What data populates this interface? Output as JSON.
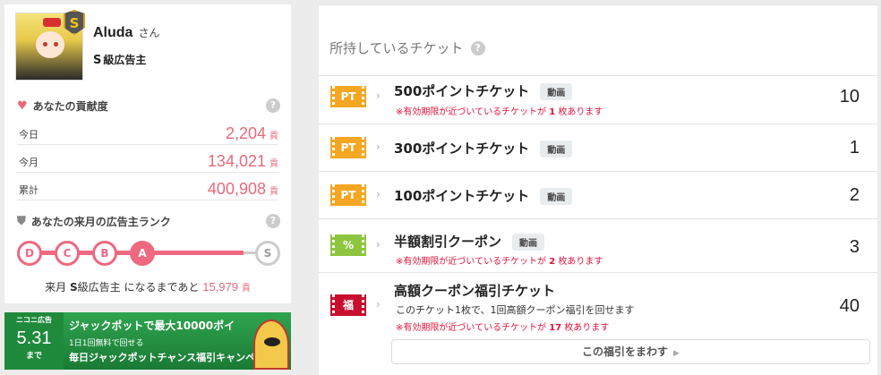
{
  "user": {
    "name": "Aluda",
    "honorific": "さん",
    "rank_letter": "S",
    "rank_text": "級広告主"
  },
  "contribution": {
    "title": "あなたの貢献度",
    "help": "?",
    "unit": "貢",
    "rows": [
      {
        "label": "今日",
        "value": "2,204"
      },
      {
        "label": "今月",
        "value": "134,021"
      },
      {
        "label": "累計",
        "value": "400,908"
      }
    ]
  },
  "next_rank": {
    "title": "あなたの来月の広告主ランク",
    "help": "?",
    "levels": [
      "D",
      "C",
      "B",
      "A",
      "S"
    ],
    "current": "A",
    "info_prefix": "来月",
    "info_rank_letter": "S",
    "info_rank_text": "級広告主",
    "info_middle": "になるまであと",
    "info_points": "15,979",
    "info_unit": "貢"
  },
  "banner": {
    "brand": "ニコニ広告",
    "date": "5.31",
    "date_suffix": "まで",
    "line1": "ジャックポットで最大10000ポイ",
    "line2": "1日1回無料で回せる",
    "line3": "毎日ジャックポットチャンス福引キャンペーン"
  },
  "tickets": {
    "title": "所持しているチケット",
    "help": "?",
    "items": [
      {
        "icon": "PT",
        "icon_color": "#f5a623",
        "name": "500ポイントチケット",
        "tag": "動画",
        "warn_prefix": "※有効期限が近づいているチケットが",
        "warn_count": "1",
        "warn_suffix": "枚あります",
        "count": "10"
      },
      {
        "icon": "PT",
        "icon_color": "#f5a623",
        "name": "300ポイントチケット",
        "tag": "動画",
        "count": "1"
      },
      {
        "icon": "PT",
        "icon_color": "#f5a623",
        "name": "100ポイントチケット",
        "tag": "動画",
        "count": "2"
      },
      {
        "icon": "%",
        "icon_color": "#8cc63f",
        "name": "半額割引クーポン",
        "tag": "動画",
        "warn_prefix": "※有効期限が近づいているチケットが",
        "warn_count": "2",
        "warn_suffix": "枚あります",
        "count": "3"
      },
      {
        "icon": "福",
        "icon_color": "#c8102e",
        "name": "高額クーポン福引チケット",
        "sub": "このチケット1枚で、1回高額クーポン福引を回せます",
        "warn_prefix": "※有効期限が近づいているチケットが",
        "warn_count": "17",
        "warn_suffix": "枚あります",
        "count": "40"
      }
    ],
    "spin_button": "この福引をまわす"
  },
  "colors": {
    "accent_pink": "#e8697b",
    "warn_red": "#e0143c",
    "pt_orange": "#f5a623",
    "coupon_green": "#8cc63f",
    "fuku_red": "#c8102e"
  }
}
